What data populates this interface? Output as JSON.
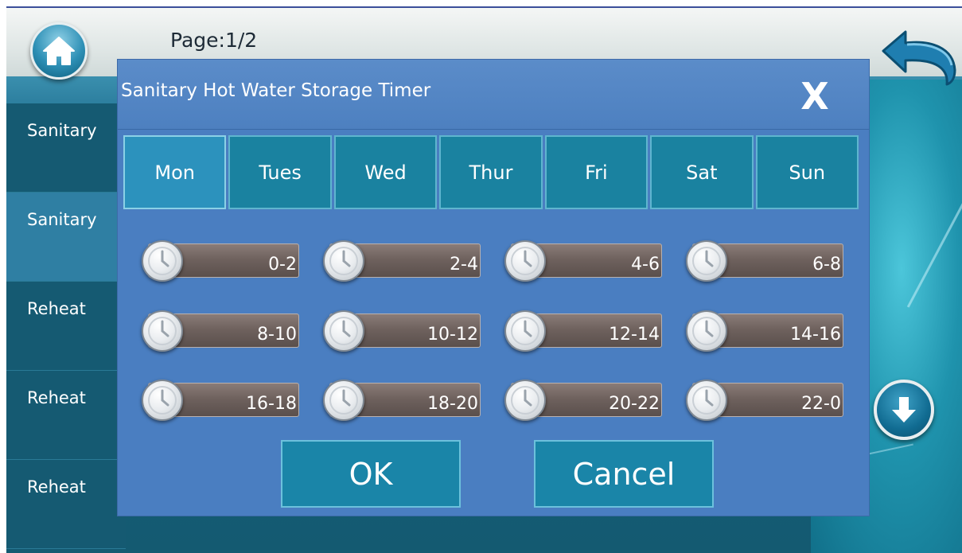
{
  "header": {
    "page_indicator": "Page:1/2"
  },
  "sidebar": {
    "items": [
      {
        "label": "Sanitary"
      },
      {
        "label": "Sanitary"
      },
      {
        "label": "Reheat"
      },
      {
        "label": "Reheat"
      },
      {
        "label": "Reheat"
      }
    ]
  },
  "dialog": {
    "title": "Sanitary Hot Water Storage Timer",
    "close_label": "X",
    "days": [
      "Mon",
      "Tues",
      "Wed",
      "Thur",
      "Fri",
      "Sat",
      "Sun"
    ],
    "selected_day": "Mon",
    "slots": [
      "0-2",
      "2-4",
      "4-6",
      "6-8",
      "8-10",
      "10-12",
      "12-14",
      "14-16",
      "16-18",
      "18-20",
      "20-22",
      "22-0"
    ],
    "ok_label": "OK",
    "cancel_label": "Cancel"
  },
  "icons": {
    "home": "home-icon",
    "back": "back-arrow-icon",
    "down": "down-arrow-icon",
    "slot": "clock-icon"
  },
  "colors": {
    "dialog_bg": "#4a7ec1",
    "tab_bg": "#1a82a0",
    "slot_bar": "#6f625e",
    "sidebar_dark": "#155a72",
    "sidebar_light": "#2f7fa3"
  }
}
